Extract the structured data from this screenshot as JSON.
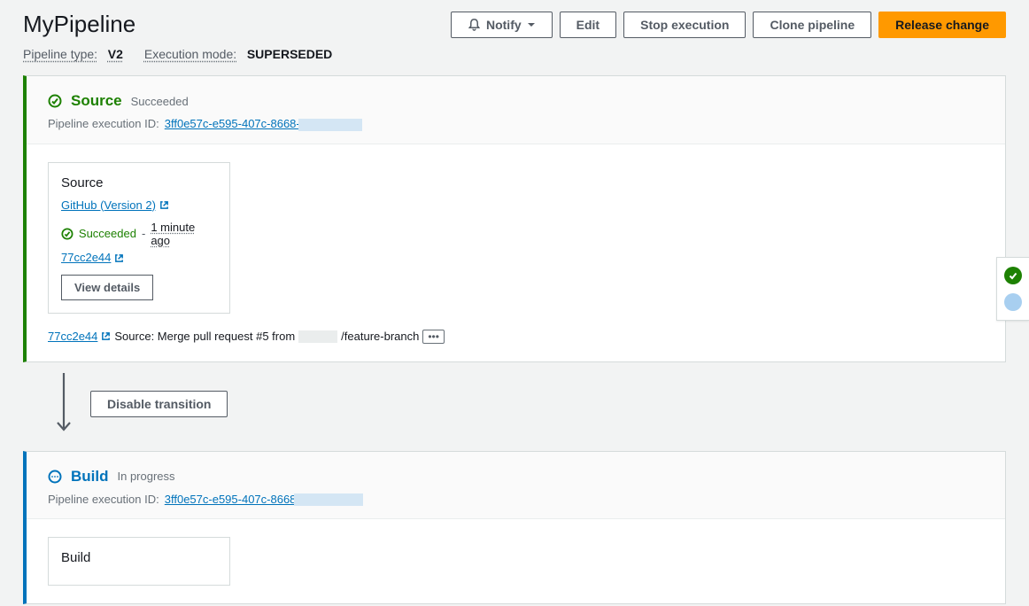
{
  "header": {
    "title": "MyPipeline",
    "meta": {
      "pipeline_type_label": "Pipeline type:",
      "pipeline_type_value": "V2",
      "execution_mode_label": "Execution mode:",
      "execution_mode_value": "SUPERSEDED"
    },
    "buttons": {
      "notify": "Notify",
      "edit": "Edit",
      "stop": "Stop execution",
      "clone": "Clone pipeline",
      "release": "Release change"
    }
  },
  "stages": {
    "source": {
      "name": "Source",
      "status_text": "Succeeded",
      "exec_id_label": "Pipeline execution ID:",
      "exec_id_prefix": "3ff0e57c-e595-407c-8668-",
      "action": {
        "title": "Source",
        "provider": "GitHub (Version 2)",
        "status": "Succeeded",
        "time": "1 minute ago",
        "commit": "77cc2e44",
        "view_details": "View details"
      },
      "commit_message": {
        "commit": "77cc2e44",
        "prefix": "Source: Merge pull request #5 from ",
        "suffix": "/feature-branch"
      }
    },
    "build": {
      "name": "Build",
      "status_text": "In progress",
      "exec_id_label": "Pipeline execution ID:",
      "exec_id_prefix": "3ff0e57c-e595-407c-8668",
      "action": {
        "title": "Build"
      }
    }
  },
  "transition": {
    "disable": "Disable transition"
  },
  "icons": {
    "notify": "notify-bell-icon",
    "caret": "caret-down-icon",
    "check_circle": "check-circle-icon",
    "in_progress": "in-progress-icon",
    "external": "external-link-icon",
    "arrow_down": "arrow-down-icon",
    "more": "more-icon"
  }
}
